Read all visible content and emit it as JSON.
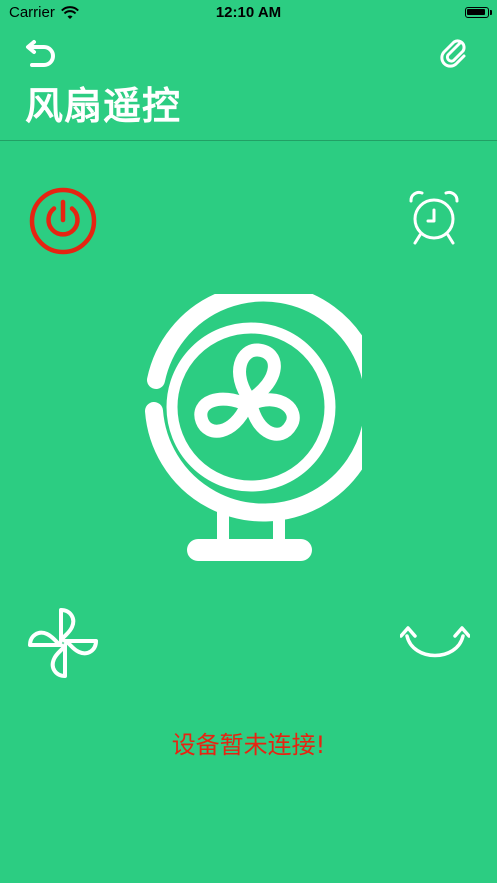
{
  "status_bar": {
    "carrier": "Carrier",
    "time": "12:10 AM",
    "battery_level": 1.0
  },
  "header": {
    "title": "风扇遥控"
  },
  "icons": {
    "back": "undo-arrow-icon",
    "attach": "paperclip-icon",
    "power": "power-icon",
    "timer": "alarm-clock-icon",
    "fan": "fan-icon",
    "wind": "wind-swirl-icon",
    "swing": "swing-arrows-icon"
  },
  "colors": {
    "background": "#2ccd82",
    "foreground": "#ffffff",
    "power": "#e62412",
    "status_text": "#e62412"
  },
  "message": {
    "status": "设备暂未连接!"
  }
}
